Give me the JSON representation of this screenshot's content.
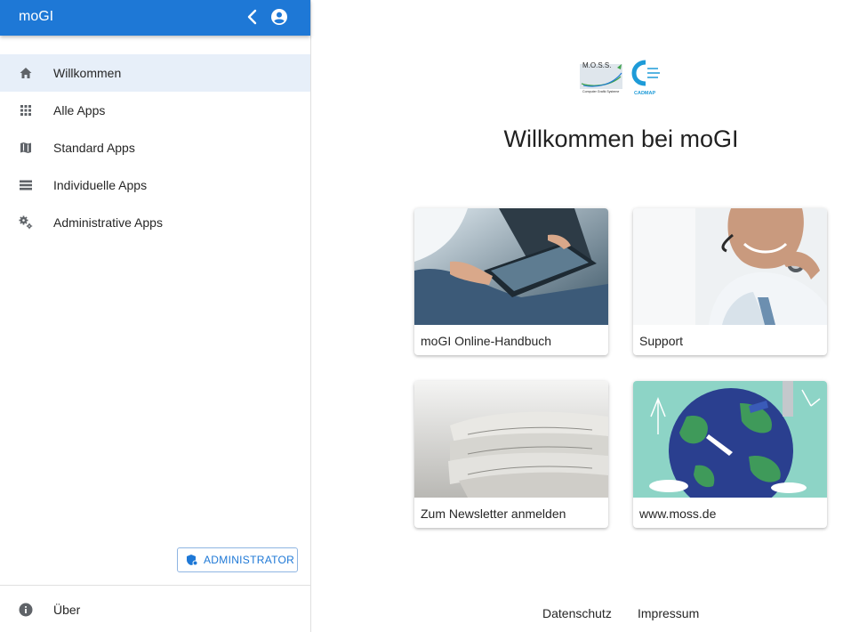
{
  "header": {
    "app_title": "moGI"
  },
  "sidebar": {
    "items": [
      {
        "label": "Willkommen",
        "icon": "home-icon",
        "active": true
      },
      {
        "label": "Alle Apps",
        "icon": "apps-grid-icon",
        "active": false
      },
      {
        "label": "Standard Apps",
        "icon": "map-icon",
        "active": false
      },
      {
        "label": "Individuelle Apps",
        "icon": "list-icon",
        "active": false
      },
      {
        "label": "Administrative Apps",
        "icon": "gears-icon",
        "active": false
      }
    ],
    "admin_button": "ADMINISTRATOR",
    "about": "Über"
  },
  "logo": {
    "moss_text": "M.O.S.S.",
    "moss_subtext": "Computer Grafik Systeme",
    "cadmap_text": "CADMAP"
  },
  "main": {
    "title": "Willkommen bei moGI",
    "cards": [
      {
        "label": "moGI Online-Handbuch",
        "image": "tablet-photo"
      },
      {
        "label": "Support",
        "image": "headset-photo"
      },
      {
        "label": "Zum Newsletter anmelden",
        "image": "newspapers-photo"
      },
      {
        "label": "www.moss.de",
        "image": "globe-illustration"
      }
    ]
  },
  "footer": {
    "links": [
      "Datenschutz",
      "Impressum"
    ]
  },
  "colors": {
    "primary": "#1e78d6",
    "active_bg": "#e7eff9",
    "icon_gray": "#5f6368"
  }
}
